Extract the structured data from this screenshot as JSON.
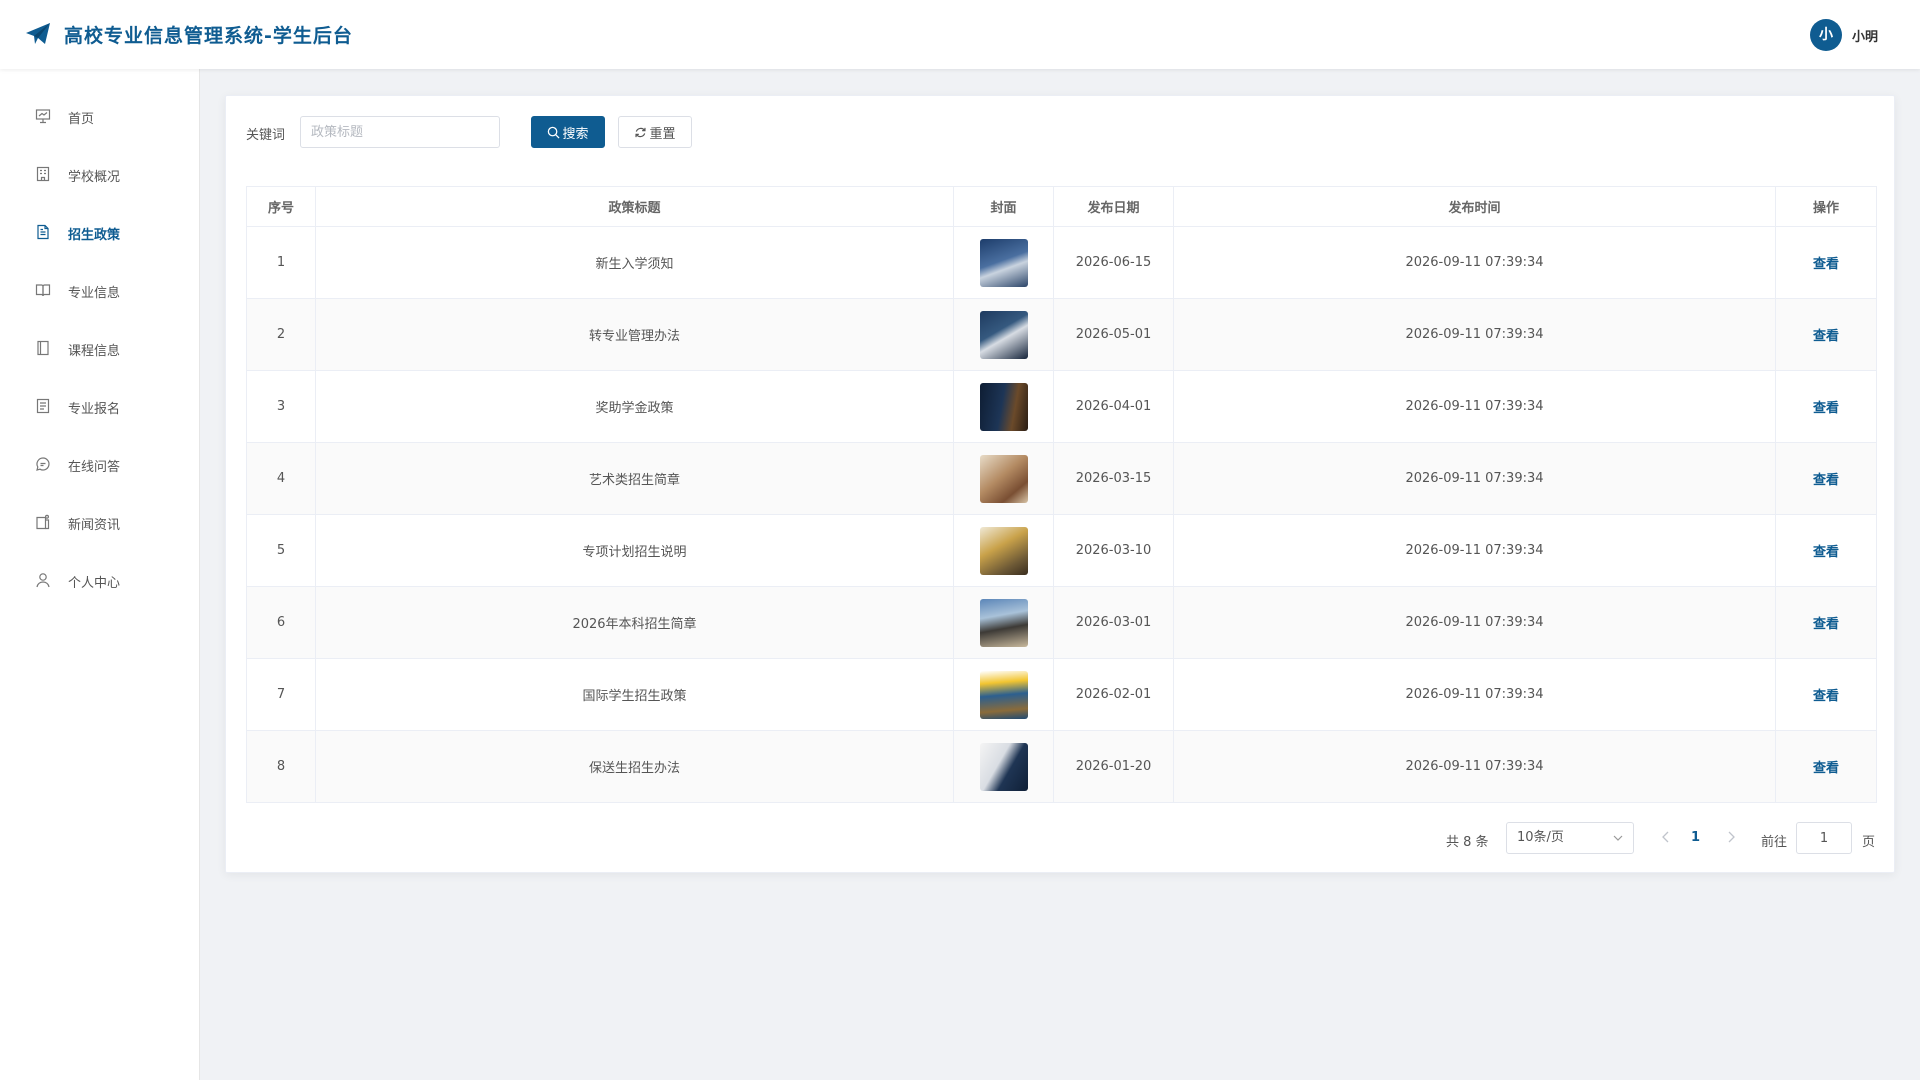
{
  "app": {
    "title": "高校专业信息管理系统-学生后台",
    "brand_color": "#0f5c91"
  },
  "user": {
    "avatar_text": "小",
    "name": "小明"
  },
  "sidebar": {
    "items": [
      {
        "label": "首页",
        "icon": "presentation-icon",
        "active": false
      },
      {
        "label": "学校概况",
        "icon": "building-icon",
        "active": false
      },
      {
        "label": "招生政策",
        "icon": "document-icon",
        "active": true
      },
      {
        "label": "专业信息",
        "icon": "book-icon",
        "active": false
      },
      {
        "label": "课程信息",
        "icon": "notebook-icon",
        "active": false
      },
      {
        "label": "专业报名",
        "icon": "form-icon",
        "active": false
      },
      {
        "label": "在线问答",
        "icon": "chat-icon",
        "active": false
      },
      {
        "label": "新闻资讯",
        "icon": "news-icon",
        "active": false
      },
      {
        "label": "个人中心",
        "icon": "user-icon",
        "active": false
      }
    ]
  },
  "search": {
    "label": "关键词",
    "placeholder": "政策标题",
    "value": "",
    "search_button": "搜索",
    "reset_button": "重置"
  },
  "table": {
    "headers": [
      "序号",
      "政策标题",
      "封面",
      "发布日期",
      "发布时间",
      "操作"
    ],
    "rows": [
      {
        "index": "1",
        "title": "新生入学须知",
        "date": "2026-06-15",
        "time": "2026-09-11 07:39:34",
        "action": "查看"
      },
      {
        "index": "2",
        "title": "转专业管理办法",
        "date": "2026-05-01",
        "time": "2026-09-11 07:39:34",
        "action": "查看"
      },
      {
        "index": "3",
        "title": "奖助学金政策",
        "date": "2026-04-01",
        "time": "2026-09-11 07:39:34",
        "action": "查看"
      },
      {
        "index": "4",
        "title": "艺术类招生简章",
        "date": "2026-03-15",
        "time": "2026-09-11 07:39:34",
        "action": "查看"
      },
      {
        "index": "5",
        "title": "专项计划招生说明",
        "date": "2026-03-10",
        "time": "2026-09-11 07:39:34",
        "action": "查看"
      },
      {
        "index": "6",
        "title": "2026年本科招生简章",
        "date": "2026-03-01",
        "time": "2026-09-11 07:39:34",
        "action": "查看"
      },
      {
        "index": "7",
        "title": "国际学生招生政策",
        "date": "2026-02-01",
        "time": "2026-09-11 07:39:34",
        "action": "查看"
      },
      {
        "index": "8",
        "title": "保送生招生办法",
        "date": "2026-01-20",
        "time": "2026-09-11 07:39:34",
        "action": "查看"
      }
    ]
  },
  "pagination": {
    "total": "共 8 条",
    "page_size": "10条/页",
    "current_page": "1",
    "goto_label": "前往",
    "goto_value": "1",
    "goto_unit": "页"
  }
}
